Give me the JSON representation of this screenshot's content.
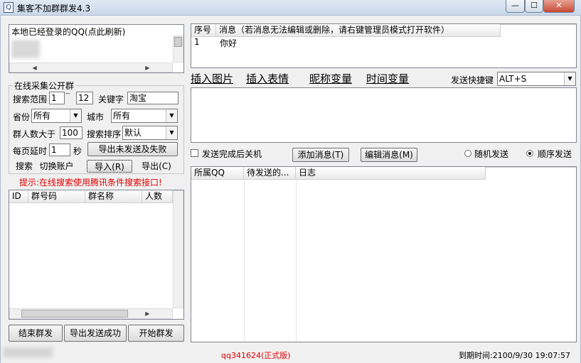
{
  "window": {
    "title": "集客不加群群发4.3",
    "app_icon_glyph": "Q",
    "min_glyph": "—",
    "max_glyph": "☐",
    "close_glyph": "✕"
  },
  "login": {
    "label": "本地已经登录的QQ(点此刷新)"
  },
  "search": {
    "group_label": "在线采集公开群",
    "range_label": "搜索范围",
    "range_from": "1",
    "range_sep": "--",
    "range_to": "12",
    "keyword_label": "关键字",
    "keyword_value": "淘宝",
    "province_label": "省份",
    "province_value": "所有",
    "city_label": "城市",
    "city_value": "所有",
    "members_label": "群人数大于",
    "members_value": "100",
    "sort_label": "搜索排序",
    "sort_value": "默认",
    "delay_label": "每页延时",
    "delay_value": "1",
    "delay_unit": "秒",
    "export_unsent_label": "导出未发送及失败",
    "search_btn": "搜索",
    "switch_account_btn": "切换账户",
    "import_btn": "导入(R)",
    "export_btn": "导出(C)"
  },
  "hint": "提示:在线搜索使用腾讯条件搜索接口!",
  "group_table": {
    "columns": [
      "ID",
      "群号码",
      "群名称",
      "人数"
    ]
  },
  "bottom_buttons": {
    "end": "结束群发",
    "export_success": "导出发送成功",
    "start": "开始群发"
  },
  "messages_table": {
    "columns": [
      "序号",
      "消息（若消息无法编辑或删除，请右键管理员模式打开软件）"
    ],
    "rows": [
      {
        "index": "1",
        "message": "你好"
      }
    ]
  },
  "toolbar": {
    "insert_image": "插入图片",
    "insert_emoji": "插入表情",
    "nickname_var": "昵称变量",
    "time_var": "时间变量",
    "hotkey_label": "发送快捷键",
    "hotkey_value": "ALT+S"
  },
  "options": {
    "shutdown_label": "发送完成后关机",
    "shutdown_checked": false,
    "add_message_btn": "添加消息(T)",
    "edit_message_btn": "编辑消息(M)",
    "random_label": "随机发送",
    "random_selected": false,
    "sequence_label": "顺序发送",
    "sequence_selected": true
  },
  "log_table": {
    "columns": [
      "所属QQ",
      "待发送的...",
      "日志"
    ]
  },
  "status": {
    "version": "qq341624(正式版)",
    "expire": "到期时间:2100/9/30 19:07:57"
  }
}
